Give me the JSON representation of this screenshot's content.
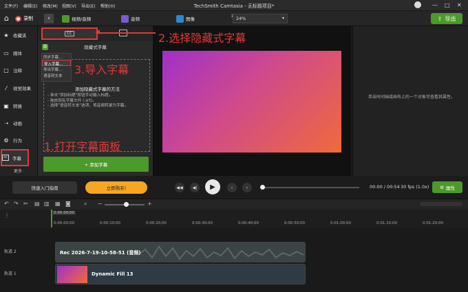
{
  "menu": {
    "items": [
      "文件(F)",
      "编辑(E)",
      "修改(M)",
      "视图(V)",
      "导出(E)",
      "帮助(H)"
    ],
    "title": "TechSmith Camtasia - 无标题项目*",
    "window_controls": [
      "—",
      "□",
      "✕"
    ]
  },
  "toolbar": {
    "record_label": "录制",
    "tabs": [
      "视频/音频",
      "音频",
      "图像"
    ],
    "zoom_value": "24%",
    "export_label": "导出"
  },
  "sidebar": {
    "items": [
      "收藏夹",
      "媒体",
      "注释",
      "视觉效果",
      "转换",
      "动画",
      "行为",
      "字幕"
    ],
    "more_label": "更多"
  },
  "panel": {
    "cc_badge": "CC",
    "subtitle": "隐藏式字幕",
    "menu": [
      "同步字幕...",
      "导入字幕...",
      "导出字幕...",
      "语音到文本"
    ],
    "howto_title": "添加隐藏式字幕的方法",
    "bullets": [
      "- 单击\"添加标题\"按钮手动输入标题。",
      "- 拖放现有字幕文件 (.srt)。",
      "- 选择\"语音转文本\"选项，将音频转录为字幕。"
    ],
    "add_button": "+ 添加字幕"
  },
  "properties": {
    "hint": "单击时间轴或画布上的一个对象可查看其属性。"
  },
  "annotations": {
    "step1": "1.打开字幕面板",
    "step2": "2.选择隐藏式字幕",
    "step3": "3.导入字幕"
  },
  "player": {
    "quick_guide": "快速入门指南",
    "buy_now": "立即购买!",
    "time": "00:00 / 00:54",
    "fps": "30 fps (1.0x)",
    "properties_button": "属性"
  },
  "timeline": {
    "playhead_time": "0:00:00;00",
    "ruler": [
      "0:00:00;00",
      "0:00:10;00",
      "0:00:20;00",
      "0:00:30;00",
      "0:00:40;00",
      "0:00:50;00",
      "0:01:00;00",
      "0:01:10;00",
      "0:01:20;00"
    ],
    "tracks": [
      {
        "name": "轨道 2",
        "clip": "Rec 2026-7-19-10-58-51 (音频)"
      },
      {
        "name": "轨道 1",
        "clip": "Dynamic Fill 13"
      }
    ]
  },
  "colors": {
    "accent_green": "#4c9a2a",
    "annotation_red": "#e03a3a",
    "buy_orange": "#f5a623"
  }
}
